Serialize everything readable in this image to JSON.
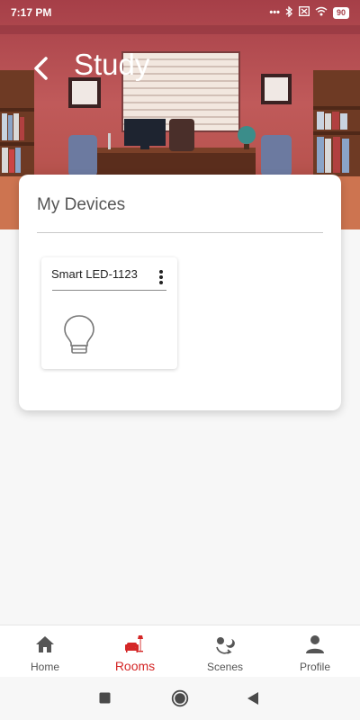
{
  "status_bar": {
    "time": "7:17 PM",
    "icons": [
      "dots-icon",
      "bluetooth-icon",
      "no-sim-icon",
      "wifi-icon",
      "battery-icon"
    ],
    "battery": "90"
  },
  "header": {
    "title": "Study",
    "background": "study-room-illustration"
  },
  "devices_card": {
    "title": "My Devices",
    "devices": [
      {
        "name": "Smart LED-1123",
        "icon": "lightbulb-icon"
      }
    ]
  },
  "bottom_nav": {
    "items": [
      {
        "label": "Home",
        "icon": "home-icon",
        "active": false
      },
      {
        "label": "Rooms",
        "icon": "armchair-lamp-icon",
        "active": true
      },
      {
        "label": "Scenes",
        "icon": "scenes-icon",
        "active": false
      },
      {
        "label": "Profile",
        "icon": "person-icon",
        "active": false
      }
    ]
  },
  "colors": {
    "accent": "#d42626",
    "header_tint": "#a63f48"
  }
}
